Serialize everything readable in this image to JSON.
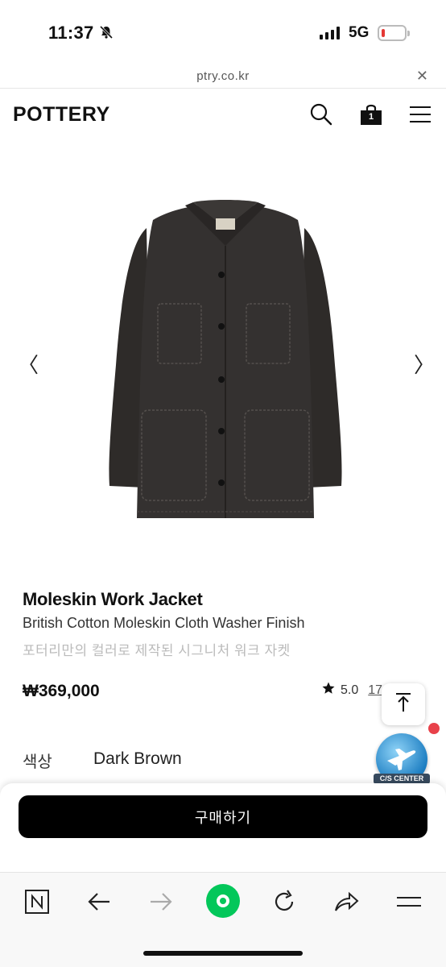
{
  "status_bar": {
    "time": "11:37",
    "network": "5G",
    "battery_level": 0.15
  },
  "browser": {
    "url": "ptry.co.kr",
    "close_icon": "close-icon"
  },
  "site": {
    "logo": "POTTERY",
    "cart_count": "1",
    "icons": [
      "search-icon",
      "shopping-bag-icon",
      "menu-icon"
    ]
  },
  "gallery": {
    "prev_arrow": "〈",
    "next_arrow": "〉"
  },
  "product": {
    "name": "Moleskin Work Jacket",
    "subtitle": "British Cotton Moleskin Cloth Washer Finish",
    "description": "포터리만의 컬러로 제작된 시그니처 워크 자켓",
    "price": "₩369,000",
    "rating": "5.0",
    "review_count": "17",
    "option_label": "색상",
    "option_value": "Dark Brown"
  },
  "floating": {
    "cs_label": "C/S CENTER"
  },
  "buy": {
    "button_label": "구매하기"
  },
  "colors": {
    "accent_green": "#03c75a",
    "buy_button": "#000000",
    "notification_dot": "#e8414a"
  }
}
